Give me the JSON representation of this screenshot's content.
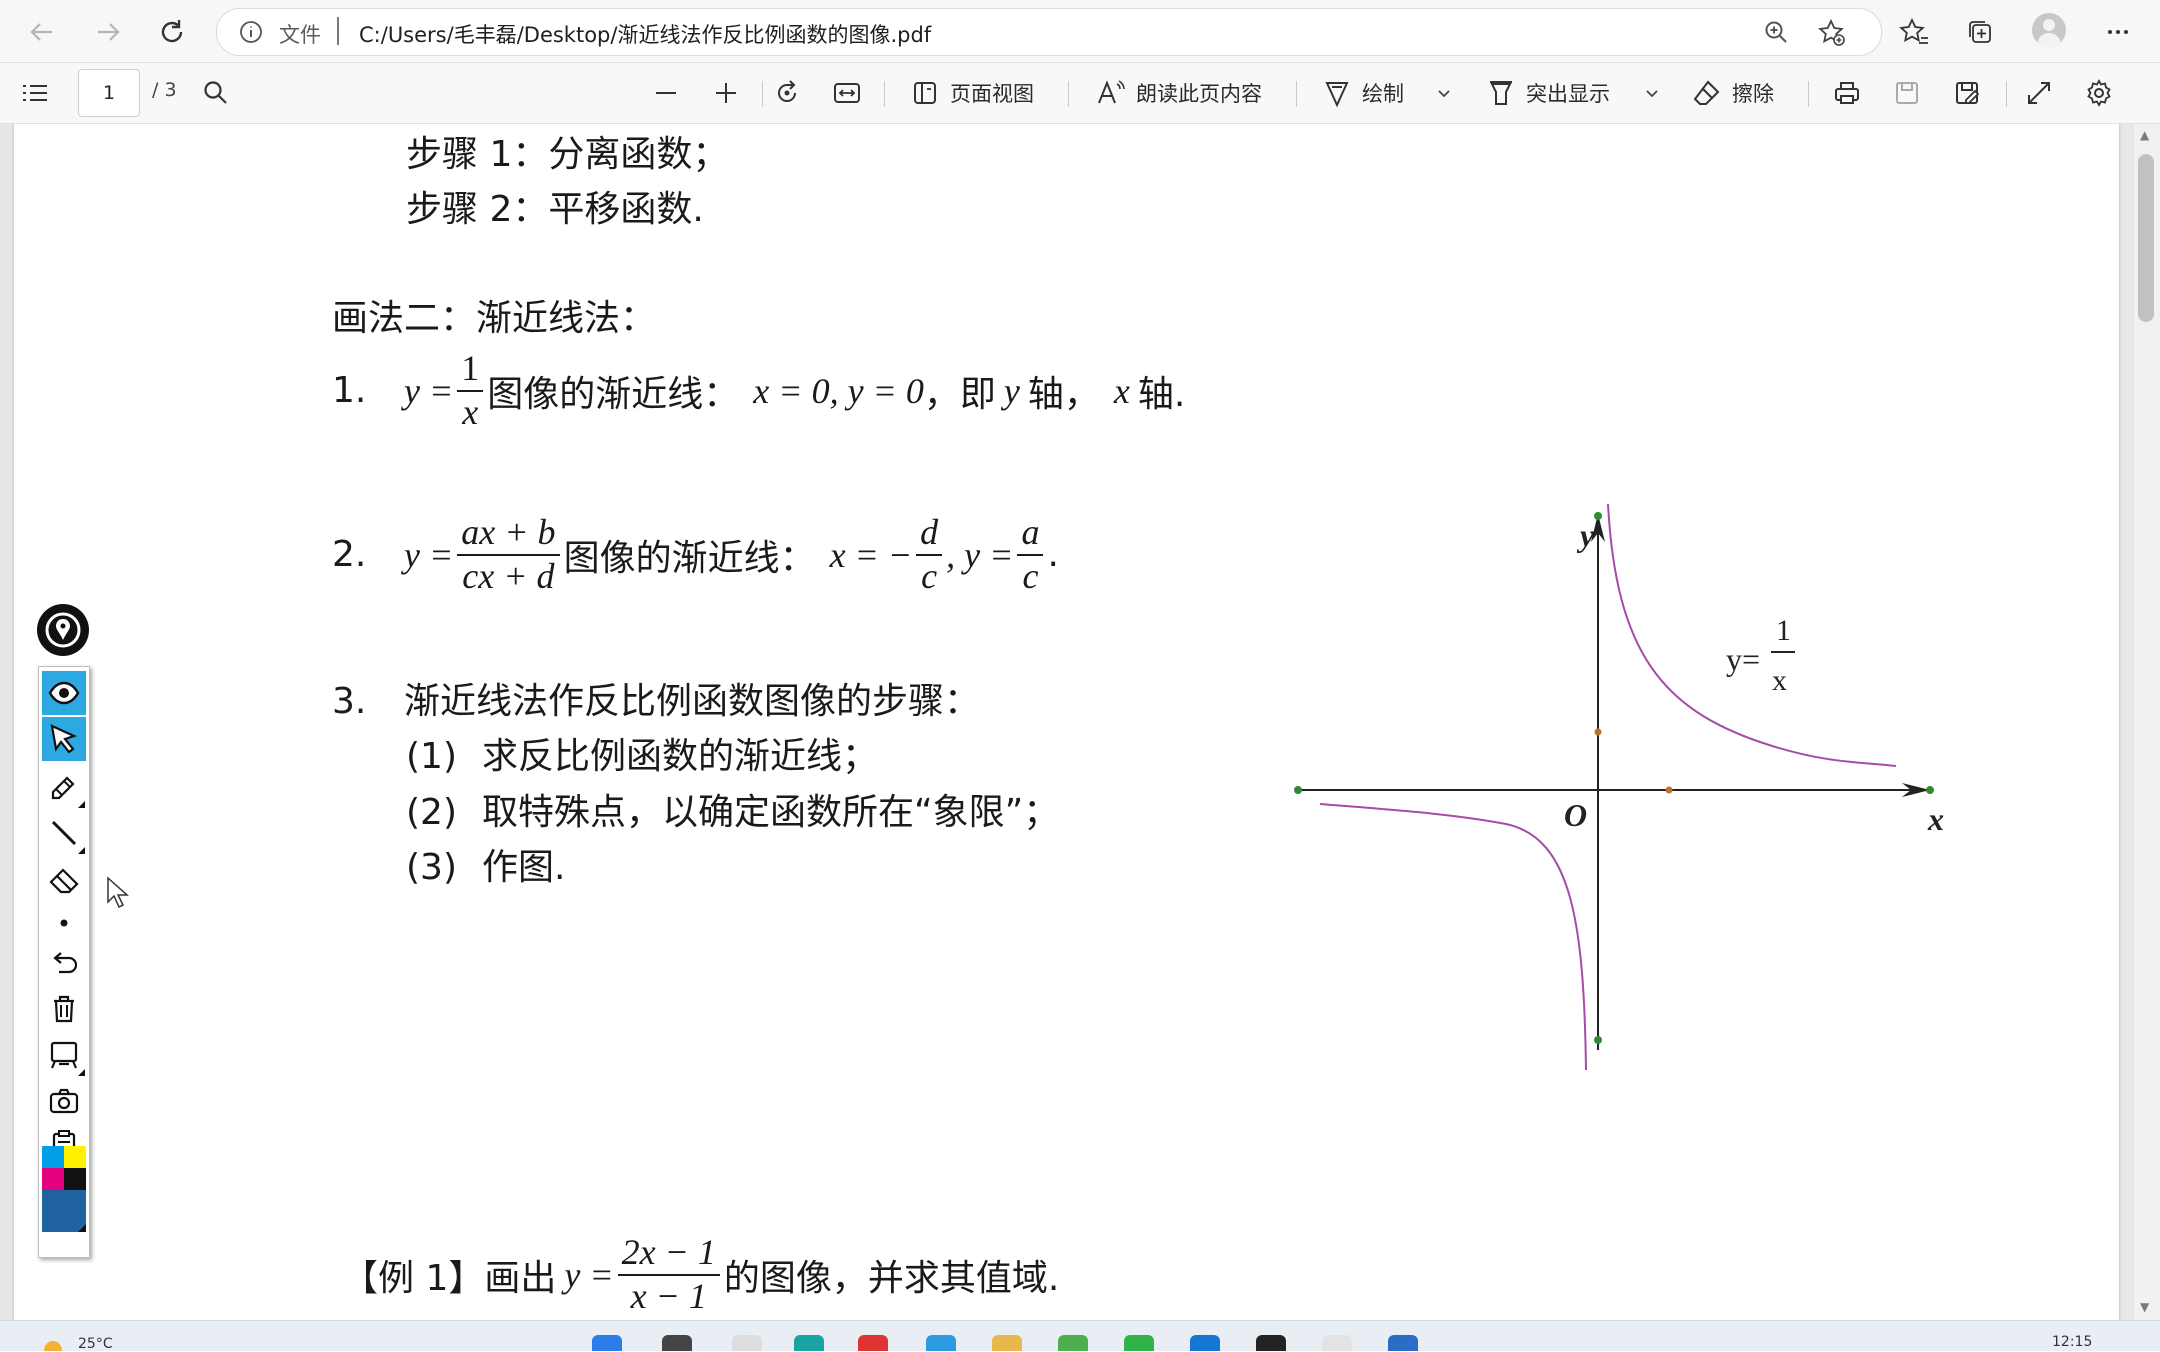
{
  "browser": {
    "address": {
      "scheme_label": "文件",
      "url": "C:/Users/毛丰磊/Desktop/渐近线法作反比例函数的图像.pdf"
    }
  },
  "pdf_toolbar": {
    "page_number": "1",
    "page_total": "/ 3",
    "page_view_label": "页面视图",
    "read_aloud_label": "朗读此页内容",
    "draw_label": "绘制",
    "highlight_label": "突出显示",
    "erase_label": "擦除"
  },
  "document": {
    "step1": "步骤 1：分离函数；",
    "step2": "步骤 2：平移函数.",
    "method2_heading": "画法二：渐近线法：",
    "item1": {
      "number": "1.",
      "y_eq": "y =",
      "frac_num": "1",
      "frac_den": "x",
      "text_mid": "图像的渐近线：",
      "asymptotes": "x = 0, y = 0",
      "text_tail_a": "，即",
      "y_var": "y",
      "text_tail_b": "轴，",
      "x_var": "x",
      "text_tail_c": "轴."
    },
    "item2": {
      "number": "2.",
      "y_eq": "y =",
      "frac_num": "ax + b",
      "frac_den": "cx + d",
      "text_mid": "图像的渐近线：",
      "x_eq": "x = −",
      "frac2_num": "d",
      "frac2_den": "c",
      "y_eq2": ", y =",
      "frac3_num": "a",
      "frac3_den": "c",
      "end": "."
    },
    "item3": {
      "number": "3.",
      "text": "渐近线法作反比例函数图像的步骤：",
      "sub1_num": "(1)",
      "sub1_text": "求反比例函数的渐近线；",
      "sub2_num": "(2)",
      "sub2_text": "取特殊点，以确定函数所在“象限”；",
      "sub3_num": "(3)",
      "sub3_text": "作图."
    },
    "example1": {
      "prefix": "【例 1】画出",
      "y_eq": "y =",
      "frac_num": "2x − 1",
      "frac_den": "x − 1",
      "suffix": "的图像，并求其值域."
    }
  },
  "graph": {
    "x_label": "x",
    "y_label": "y",
    "origin_label": "O",
    "func_label_y": "y=",
    "func_label_num": "1",
    "func_label_den": "x",
    "curve_color": "#a64ca6",
    "point_color_green": "#2e8b2e",
    "point_color_orange": "#b7752b"
  },
  "taskbar": {
    "temperature": "25°C",
    "clock": "12:15"
  }
}
